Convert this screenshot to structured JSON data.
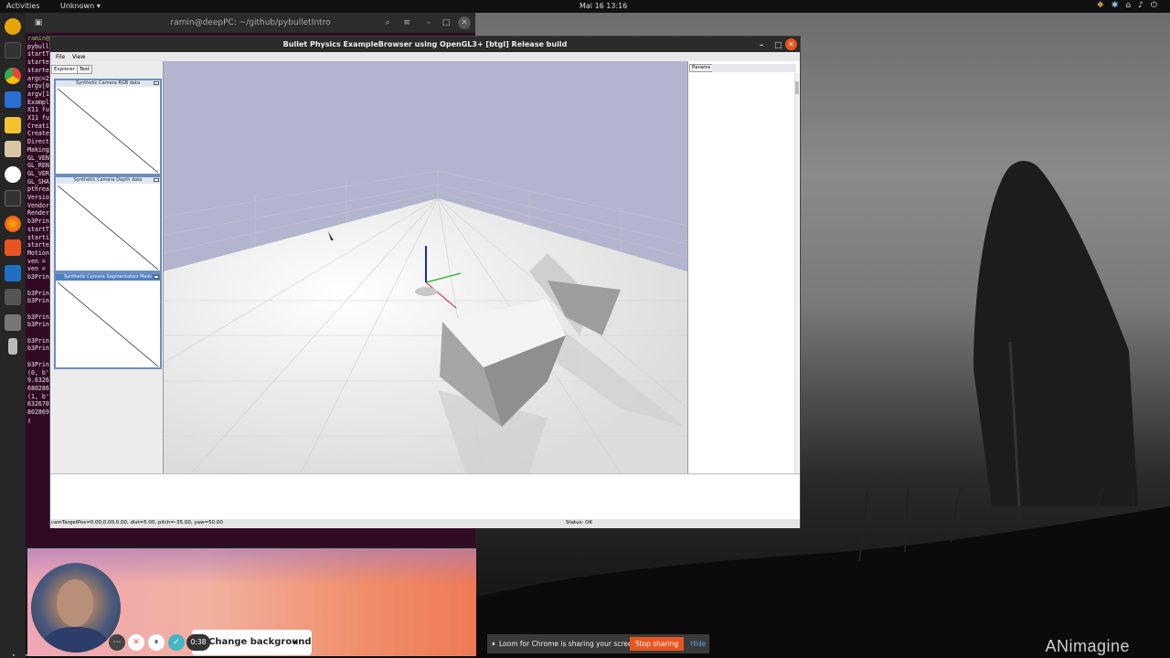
{
  "topbar": {
    "activities": "Activities",
    "app_menu": "Unknown",
    "clock": "Mai 16  13:16",
    "icons": [
      "dropbox-icon",
      "bluetooth-icon",
      "network-icon",
      "volume-icon",
      "power-icon"
    ]
  },
  "terminal": {
    "title": "ramin@deepPC: ~/github/pybulletIntro",
    "lines": [
      "ramin@",
      "pybull",
      "startT",
      "starte",
      "starte",
      "argc=2",
      "argv[0",
      "argv[1",
      "Exampl",
      "X11 fu",
      "X11 fu",
      "Creati",
      "Create",
      "Direct",
      "Making",
      "GL_VEN",
      "GL_REN",
      "GL_VER",
      "GL_SHA",
      "pthrea",
      "Versio",
      "Vendor",
      "Render",
      "b3Prin",
      "startT",
      "starti",
      "starte",
      "Motion",
      "ven = ",
      "ven = ",
      "b3Prin",
      "",
      "b3Prin",
      "b3Prin",
      "",
      "b3Prin",
      "b3Prin",
      "",
      "b3Prin",
      "b3Prin",
      "",
      "b3Prin",
      "(0, b'",
      "9.6326",
      "680286",
      "(1, b'",
      "632670",
      "802869",
      "▯"
    ]
  },
  "bullet_window": {
    "title": "Bullet Physics ExampleBrowser using OpenGL3+ [btgl] Release build",
    "menu": [
      "File",
      "View"
    ],
    "explorer_tabs": [
      "Explorer",
      "Test"
    ],
    "camera_panels": [
      "Synthetic Camera RGB data",
      "Synthetic Camera Depth data",
      "Synthetic Camera Segmentation Mask"
    ],
    "params_tab": "Params",
    "status_left": "camTargetPos=0.00,0.00,0.00, dist=5.00, pitch=-35.00, yaw=50.00",
    "status_right": "Status: OK"
  },
  "loom": {
    "timer": "0:38",
    "background_toggle": "Change background",
    "share_message": "Loom for Chrome is sharing your screen.",
    "stop_sharing": "Stop sharing",
    "hide": "Hide"
  },
  "wallpaper": {
    "watermark": "ANimagine"
  }
}
